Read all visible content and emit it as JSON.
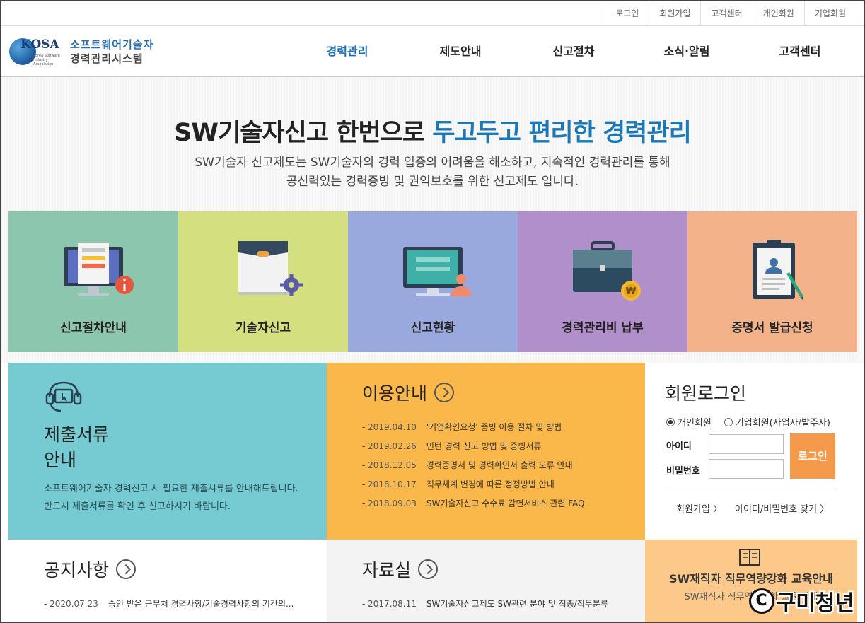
{
  "util_nav": [
    "로그인",
    "회원가입",
    "고객센터",
    "개인회원",
    "기업회원"
  ],
  "logo": {
    "kosa": "KOSA",
    "sub": "Korea Software Industry Association",
    "line1": "소프트웨어기술자",
    "line2": "경력관리시스템"
  },
  "gnb": [
    "경력관리",
    "제도안내",
    "신고절차",
    "소식·알림",
    "고객센터"
  ],
  "hero": {
    "title_a": "SW기술자신고 한번으로 ",
    "title_b": "두고두고 편리한 경력관리",
    "desc1": "SW기술자 신고제도는 SW기술자의 경력 입증의 어려움을 해소하고, 지속적인 경력관리를 통해",
    "desc2": "공신력있는 경력증빙 및 권익보호를 위한 신고제도 입니다."
  },
  "tiles": [
    {
      "label": "신고절차안내",
      "color": "#8dc6ae"
    },
    {
      "label": "기술자신고",
      "color": "#d4df7f"
    },
    {
      "label": "신고현황",
      "color": "#9aa9dd"
    },
    {
      "label": "경력관리비 납부",
      "color": "#b08fcb"
    },
    {
      "label": "증명서 발급신청",
      "color": "#f3b28a"
    }
  ],
  "docs": {
    "title_line1": "제출서류",
    "title_line2": "안내",
    "desc1": "소프트웨어기술자 경력신고 시 필요한 제출서류를 안내해드립니다.",
    "desc2": "반드시 제출서류를 확인 후 신고하시기 바랍니다."
  },
  "guide": {
    "title": "이용안내",
    "items": [
      {
        "date": "2019.04.10",
        "text": "'기업확인요청' 증빙 이용 절차 및 방법"
      },
      {
        "date": "2019.02.26",
        "text": "인턴 경력 신고 방법 및 증빙서류"
      },
      {
        "date": "2018.12.05",
        "text": "경력증명서 및 경력확인서 출력 오류 안내"
      },
      {
        "date": "2018.10.17",
        "text": "직무체계 변경에 따른 정정방법 안내"
      },
      {
        "date": "2018.09.03",
        "text": "SW기술자신고 수수료 감면서비스 관련 FAQ"
      }
    ]
  },
  "login": {
    "title": "회원로그인",
    "radio_personal": "개인회원",
    "radio_company": "기업회원(사업자/발주자)",
    "id_label": "아이디",
    "pw_label": "비밀번호",
    "button": "로그인",
    "join": "회원가입 〉",
    "find": "아이디/비밀번호 찾기 〉"
  },
  "notice": {
    "title": "공지사항",
    "items": [
      {
        "date": "2020.07.23",
        "text": "승인 받은 근무처 경력사항/기술경력사항의 기간의..."
      }
    ]
  },
  "data_room": {
    "title": "자료실",
    "items": [
      {
        "date": "2017.08.11",
        "text": "SW기술자신고제도 SW관련 분야 및 직종/직무분류"
      }
    ]
  },
  "sw_box": {
    "title": "SW재직자 직무역량강화 교육안내",
    "sub": "SW재직자 직무역량강화 교육 안내"
  },
  "watermark": {
    "c": "C",
    "text": "구미청년"
  }
}
